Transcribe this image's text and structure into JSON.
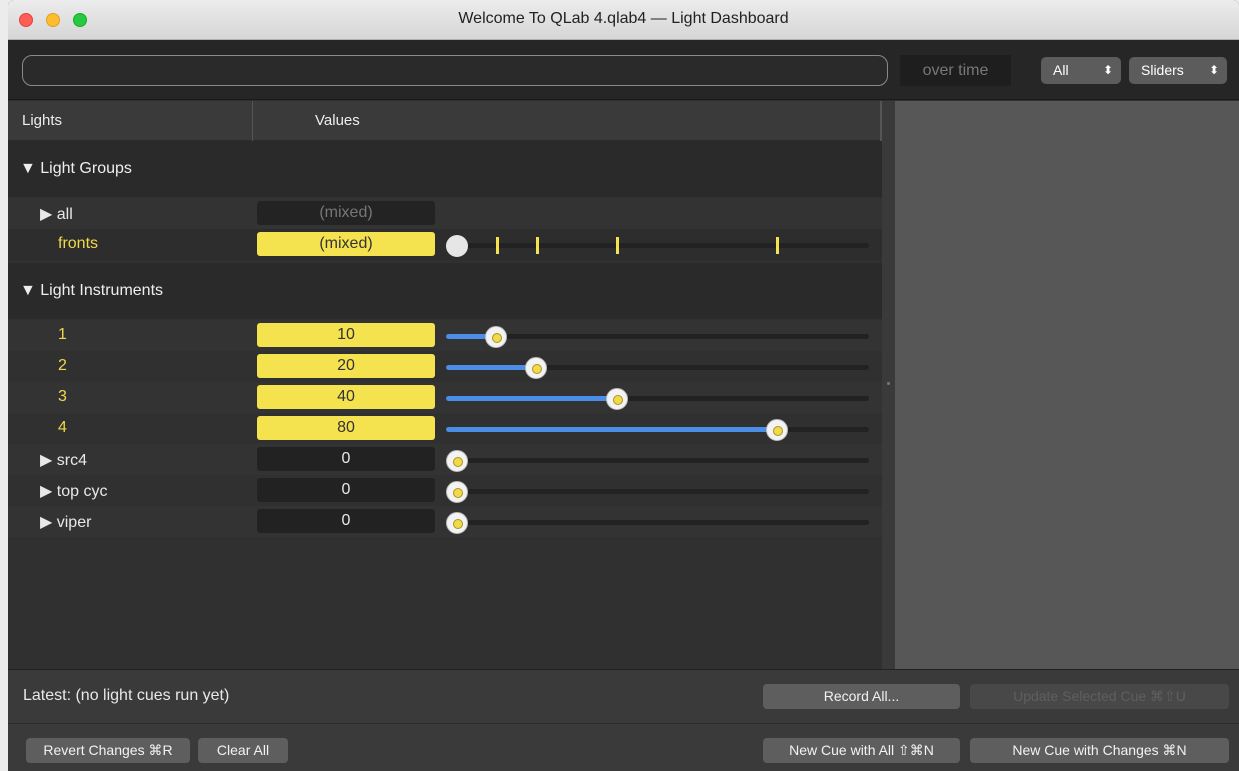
{
  "window": {
    "title": "Welcome To QLab 4.qlab4 — Light Dashboard"
  },
  "toolbar": {
    "search_value": "",
    "over_time": "over time",
    "filter_popup": {
      "selected": "All",
      "arrows": "⌃⌄"
    },
    "view_popup": {
      "selected": "Sliders",
      "arrows": "⌃⌄"
    }
  },
  "table": {
    "columns": {
      "lights": "Lights",
      "values": "Values"
    },
    "light_groups": {
      "label": "▼ Light Groups",
      "rows": [
        {
          "name": "▶ all",
          "value": "(mixed)"
        },
        {
          "name": "fronts",
          "value": "(mixed)",
          "tick_levels": [
            12,
            22,
            41,
            80
          ]
        }
      ]
    },
    "light_instruments": {
      "label": "▼ Light Instruments",
      "rows": [
        {
          "name": "1",
          "value": "10",
          "level": 0.1
        },
        {
          "name": "2",
          "value": "20",
          "level": 0.2
        },
        {
          "name": "3",
          "value": "40",
          "level": 0.4
        },
        {
          "name": "4",
          "value": "80",
          "level": 0.8
        },
        {
          "name": "▶ src4",
          "value": "0",
          "level": 0
        },
        {
          "name": "▶ top cyc",
          "value": "0",
          "level": 0
        },
        {
          "name": "▶ viper",
          "value": "0",
          "level": 0
        }
      ]
    }
  },
  "footer": {
    "latest": "Latest: (no light cues run yet)",
    "record_all": "Record All...",
    "update_selected": "Update Selected Cue ⌘⇧U",
    "revert_changes": "Revert Changes ⌘R",
    "clear_all": "Clear All",
    "new_cue_all": "New Cue with All ⇧⌘N",
    "new_cue_changes": "New Cue with Changes ⌘N"
  }
}
